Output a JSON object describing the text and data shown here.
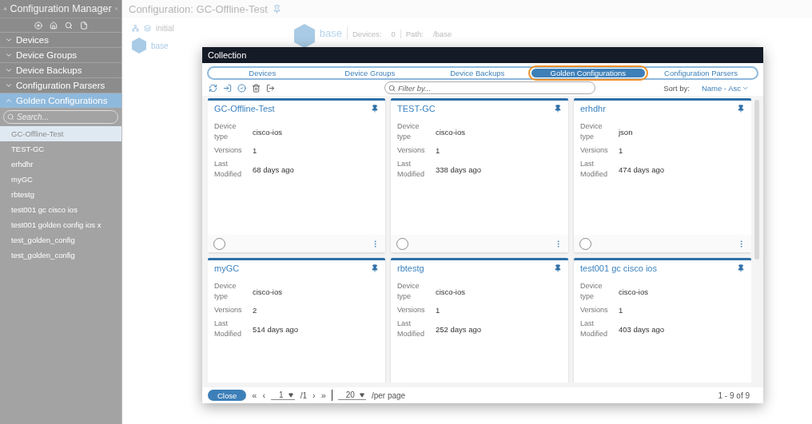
{
  "app": {
    "title": "Configuration Manager"
  },
  "sidebar": {
    "search": {
      "placeholder": "Search..."
    },
    "sections": [
      {
        "label": "Devices",
        "expanded": false
      },
      {
        "label": "Device Groups",
        "expanded": false
      },
      {
        "label": "Device Backups",
        "expanded": false
      },
      {
        "label": "Configuration Parsers",
        "expanded": false
      },
      {
        "label": "Golden Configurations",
        "expanded": true,
        "items": [
          {
            "label": "GC-Offline-Test",
            "selected": true
          },
          {
            "label": "TEST-GC",
            "selected": false
          },
          {
            "label": "erhdhr",
            "selected": false
          },
          {
            "label": "myGC",
            "selected": false
          },
          {
            "label": "rbtestg",
            "selected": false
          },
          {
            "label": "test001 gc cisco ios",
            "selected": false
          },
          {
            "label": "test001 golden config ios x",
            "selected": false
          },
          {
            "label": "test_golden_config",
            "selected": false
          },
          {
            "label": "test_golden_config",
            "selected": false
          }
        ]
      }
    ]
  },
  "page": {
    "title": "Configuration: GC-Offline-Test",
    "tree": [
      {
        "label": "initial"
      },
      {
        "label": "base"
      }
    ],
    "node": {
      "label": "base",
      "devices_label": "Devices:",
      "devices": "0",
      "path_label": "Path:",
      "path": "/base"
    }
  },
  "modal": {
    "title": "Collection",
    "tabs": [
      {
        "label": "Devices",
        "selected": false,
        "highlighted": false
      },
      {
        "label": "Device Groups",
        "selected": false,
        "highlighted": false
      },
      {
        "label": "Device Backups",
        "selected": false,
        "highlighted": false
      },
      {
        "label": "Golden Configurations",
        "selected": true,
        "highlighted": true
      },
      {
        "label": "Configuration Parsers",
        "selected": false,
        "highlighted": false
      }
    ],
    "filter": {
      "placeholder": "Filter by..."
    },
    "sort": {
      "label": "Sort by:",
      "value": "Name - Asc"
    },
    "cards": [
      {
        "name": "GC-Offline-Test",
        "checked": false,
        "fields": [
          {
            "label": "Device type",
            "value": "cisco-ios"
          },
          {
            "label": "Versions",
            "value": "1"
          },
          {
            "label": "Last Modified",
            "value": "68 days ago"
          }
        ]
      },
      {
        "name": "TEST-GC",
        "checked": false,
        "fields": [
          {
            "label": "Device type",
            "value": "cisco-ios"
          },
          {
            "label": "Versions",
            "value": "1"
          },
          {
            "label": "Last Modified",
            "value": "338 days ago"
          }
        ]
      },
      {
        "name": "erhdhr",
        "checked": false,
        "fields": [
          {
            "label": "Device type",
            "value": "json"
          },
          {
            "label": "Versions",
            "value": "1"
          },
          {
            "label": "Last Modified",
            "value": "474 days ago"
          }
        ]
      },
      {
        "name": "myGC",
        "fields": [
          {
            "label": "Device type",
            "value": "cisco-ios"
          },
          {
            "label": "Versions",
            "value": "2"
          },
          {
            "label": "Last Modified",
            "value": "514 days ago"
          }
        ]
      },
      {
        "name": "rbtestg",
        "fields": [
          {
            "label": "Device type",
            "value": "cisco-ios"
          },
          {
            "label": "Versions",
            "value": "1"
          },
          {
            "label": "Last Modified",
            "value": "252 days ago"
          }
        ]
      },
      {
        "name": "test001 gc cisco ios",
        "fields": [
          {
            "label": "Device type",
            "value": "cisco-ios"
          },
          {
            "label": "Versions",
            "value": "1"
          },
          {
            "label": "Last Modified",
            "value": "403 days ago"
          }
        ]
      }
    ],
    "footer": {
      "close": "Close",
      "first": "«",
      "prev": "‹",
      "page": "1",
      "pages": "/1",
      "next": "›",
      "last": "»",
      "per_page": "20",
      "per_page_label": "/per page",
      "range": "1 - 9 of 9"
    }
  }
}
